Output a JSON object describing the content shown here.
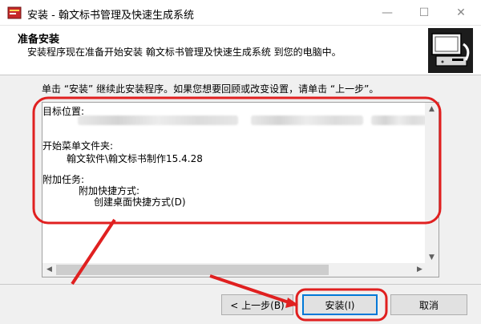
{
  "window": {
    "title": "安装 - 翰文标书管理及快速生成系统",
    "minimize_glyph": "—",
    "maximize_glyph": "☐",
    "close_glyph": "✕"
  },
  "header": {
    "title": "准备安装",
    "subtitle": "安装程序现在准备开始安装 翰文标书管理及快速生成系统 到您的电脑中。"
  },
  "content": {
    "instruction": "单击 “安装” 继续此安装程序。如果您想要回顾或改变设置，请单击 “上一步”。",
    "memo": {
      "dest_label": "目标位置:",
      "start_menu_label": "开始菜单文件夹:",
      "start_menu_value": "翰文软件\\翰文标书制作15.4.28",
      "tasks_label": "附加任务:",
      "tasks_group": "附加快捷方式:",
      "tasks_item": "创建桌面快捷方式(D)"
    }
  },
  "buttons": {
    "back": "< 上一步(B)",
    "install": "安装(I)",
    "cancel": "取消"
  },
  "icons": {
    "app": "installer-app-icon",
    "setup": "computer-setup-icon"
  },
  "colors": {
    "annotation": "#e02020",
    "focus": "#0078d7"
  }
}
